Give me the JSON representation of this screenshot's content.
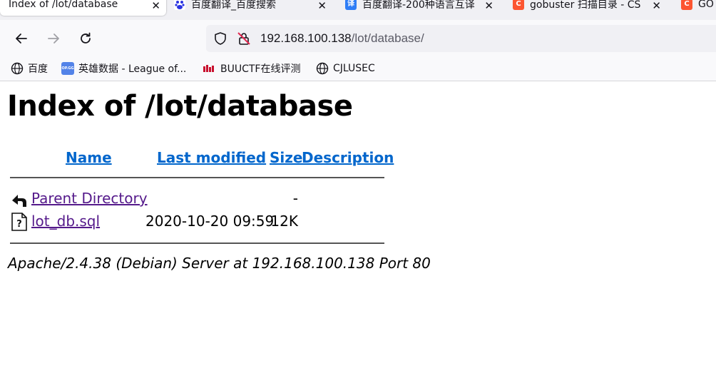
{
  "browser": {
    "tabs": [
      {
        "title": "Index of /lot/database",
        "active": true,
        "favicon": "none"
      },
      {
        "title": "百度翻译_百度搜索",
        "active": false,
        "favicon": "baidu-paw-icon"
      },
      {
        "title": "百度翻译-200种语言互译",
        "active": false,
        "favicon": "baidu-translate-icon"
      },
      {
        "title": "gobuster 扫描目录 - CS",
        "active": false,
        "favicon": "csdn-icon"
      },
      {
        "title": "GO",
        "active": false,
        "favicon": "csdn-icon"
      }
    ],
    "url": {
      "host": "192.168.100.138",
      "path": "/lot/database/"
    },
    "bookmarks": [
      {
        "label": "百度",
        "icon": "globe-icon"
      },
      {
        "label": "英雄数据 - League of...",
        "icon": "opgg-icon",
        "icon_text": "OP.GG"
      },
      {
        "label": "BUUCTF在线评测",
        "icon": "buuctf-icon"
      },
      {
        "label": "CJLUSEC",
        "icon": "globe-icon"
      }
    ]
  },
  "page": {
    "heading": "Index of /lot/database",
    "columns": {
      "name": "Name",
      "last_modified": "Last modified",
      "size": "Size",
      "description": "Description"
    },
    "rows": [
      {
        "name": "Parent Directory",
        "modified": "",
        "size": "-",
        "icon": "back-arrow-icon"
      },
      {
        "name": "lot_db.sql",
        "modified": "2020-10-20 09:59",
        "size": "12K",
        "icon": "unknown-file-icon"
      }
    ],
    "footer": "Apache/2.4.38 (Debian) Server at 192.168.100.138 Port 80"
  },
  "colors": {
    "link": "#0066cc",
    "visited_link": "#551a8b",
    "csdn_red": "#fc5531",
    "translate_blue": "#2e7df6"
  }
}
